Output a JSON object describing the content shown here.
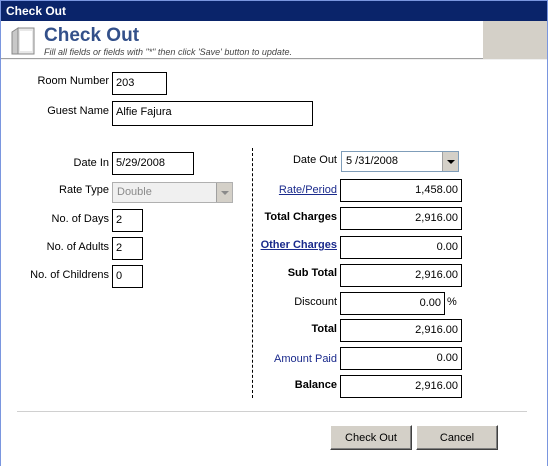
{
  "window": {
    "title": "Check Out"
  },
  "header": {
    "title": "Check Out",
    "subtitle": "Fill all fields or fields with \"*\" then click 'Save' button to update."
  },
  "left": {
    "room_number": {
      "label": "Room Number",
      "value": "203"
    },
    "guest_name": {
      "label": "Guest Name",
      "value": "Alfie Fajura"
    },
    "date_in": {
      "label": "Date In",
      "value": "5/29/2008"
    },
    "rate_type": {
      "label": "Rate Type",
      "value": "Double"
    },
    "num_days": {
      "label": "No. of Days",
      "value": "2"
    },
    "num_adults": {
      "label": "No. of Adults",
      "value": "2"
    },
    "num_childrens": {
      "label": "No. of Childrens",
      "value": "0"
    }
  },
  "right": {
    "date_out": {
      "label": "Date Out",
      "value": "5 /31/2008"
    },
    "rate_period": {
      "label": "Rate/Period",
      "value": "1,458.00"
    },
    "total_charges": {
      "label": "Total Charges",
      "value": "2,916.00"
    },
    "other_charges": {
      "label": "Other Charges",
      "value": "0.00"
    },
    "sub_total": {
      "label": "Sub Total",
      "value": "2,916.00"
    },
    "discount": {
      "label": "Discount",
      "value": "0.00",
      "unit": "%"
    },
    "total": {
      "label": "Total",
      "value": "2,916.00"
    },
    "amount_paid": {
      "label": "Amount Paid",
      "value": "0.00"
    },
    "balance": {
      "label": "Balance",
      "value": "2,916.00"
    }
  },
  "buttons": {
    "check_out": "Check Out",
    "cancel": "Cancel"
  }
}
